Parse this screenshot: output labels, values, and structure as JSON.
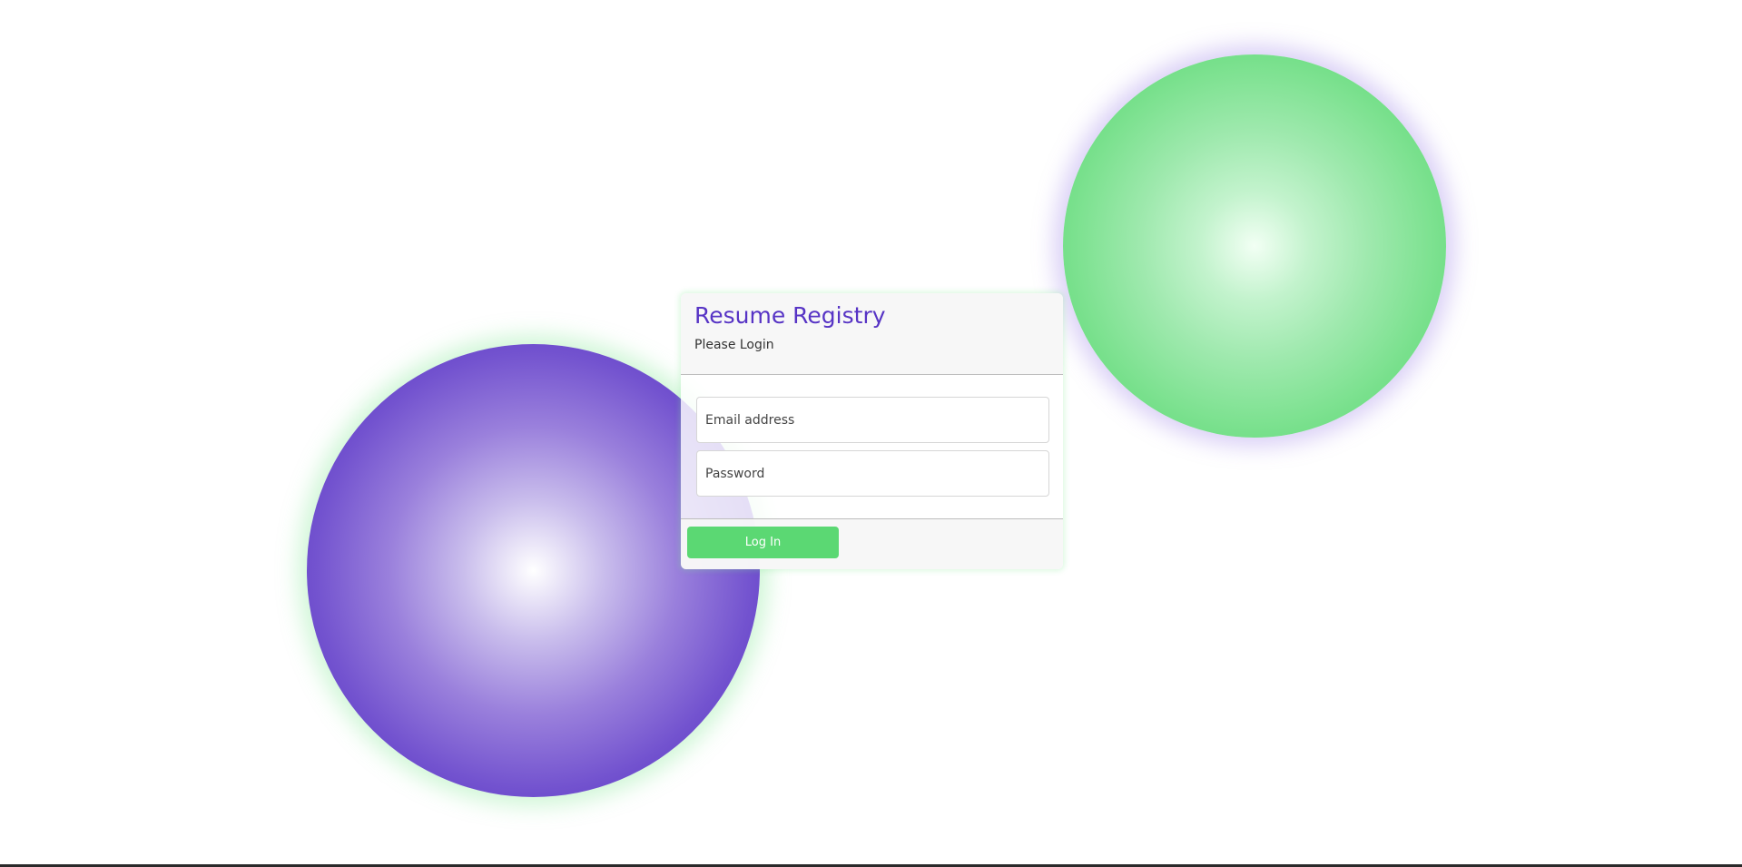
{
  "login_card": {
    "title": "Resume Registry",
    "subtitle": "Please Login",
    "email_placeholder": "Email address",
    "password_placeholder": "Password",
    "login_button_label": "Log In"
  },
  "colors": {
    "brand_purple": "#5734c5",
    "brand_green": "#5bd873"
  }
}
